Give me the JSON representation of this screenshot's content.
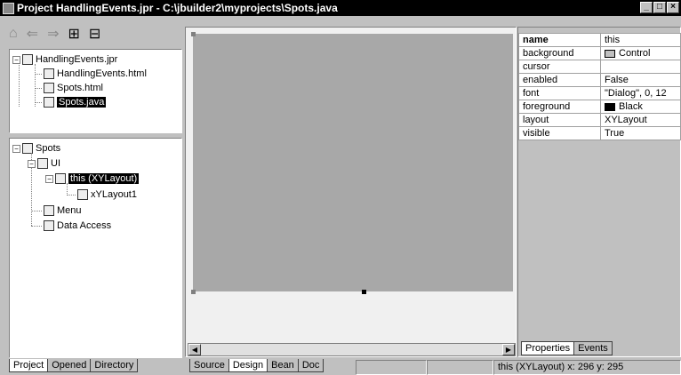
{
  "window": {
    "title": "Project HandlingEvents.jpr - C:\\jbuilder2\\myprojects\\Spots.java",
    "controls": [
      "_",
      "□",
      "×"
    ]
  },
  "toolbar": {
    "icons": [
      "home-icon",
      "back-arrow-icon",
      "forward-arrow-icon",
      "add-file-icon",
      "remove-file-icon"
    ]
  },
  "project_tree": {
    "root": "HandlingEvents.jpr",
    "files": [
      "HandlingEvents.html",
      "Spots.html",
      "Spots.java"
    ],
    "selected": "Spots.java"
  },
  "structure_tree": {
    "root": "Spots",
    "ui": "UI",
    "this_node": "this (XYLayout)",
    "layout_node": "xYLayout1",
    "menu": "Menu",
    "data_access": "Data Access"
  },
  "left_tabs": [
    "Project",
    "Opened",
    "Directory"
  ],
  "editor_tabs": [
    "Source",
    "Design",
    "Bean",
    "Doc"
  ],
  "inspector": {
    "columns": {
      "name": "name",
      "value": "this"
    },
    "properties": [
      {
        "name": "background",
        "value": "Control",
        "swatch": "#c0c0c0"
      },
      {
        "name": "cursor",
        "value": ""
      },
      {
        "name": "enabled",
        "value": "False"
      },
      {
        "name": "font",
        "value": "\"Dialog\", 0, 12"
      },
      {
        "name": "foreground",
        "value": "Black",
        "swatch": "#000000"
      },
      {
        "name": "layout",
        "value": "XYLayout"
      },
      {
        "name": "visible",
        "value": "True"
      }
    ],
    "tabs": [
      "Properties",
      "Events"
    ]
  },
  "status": {
    "text": "this (XYLayout) x: 296 y: 295"
  }
}
